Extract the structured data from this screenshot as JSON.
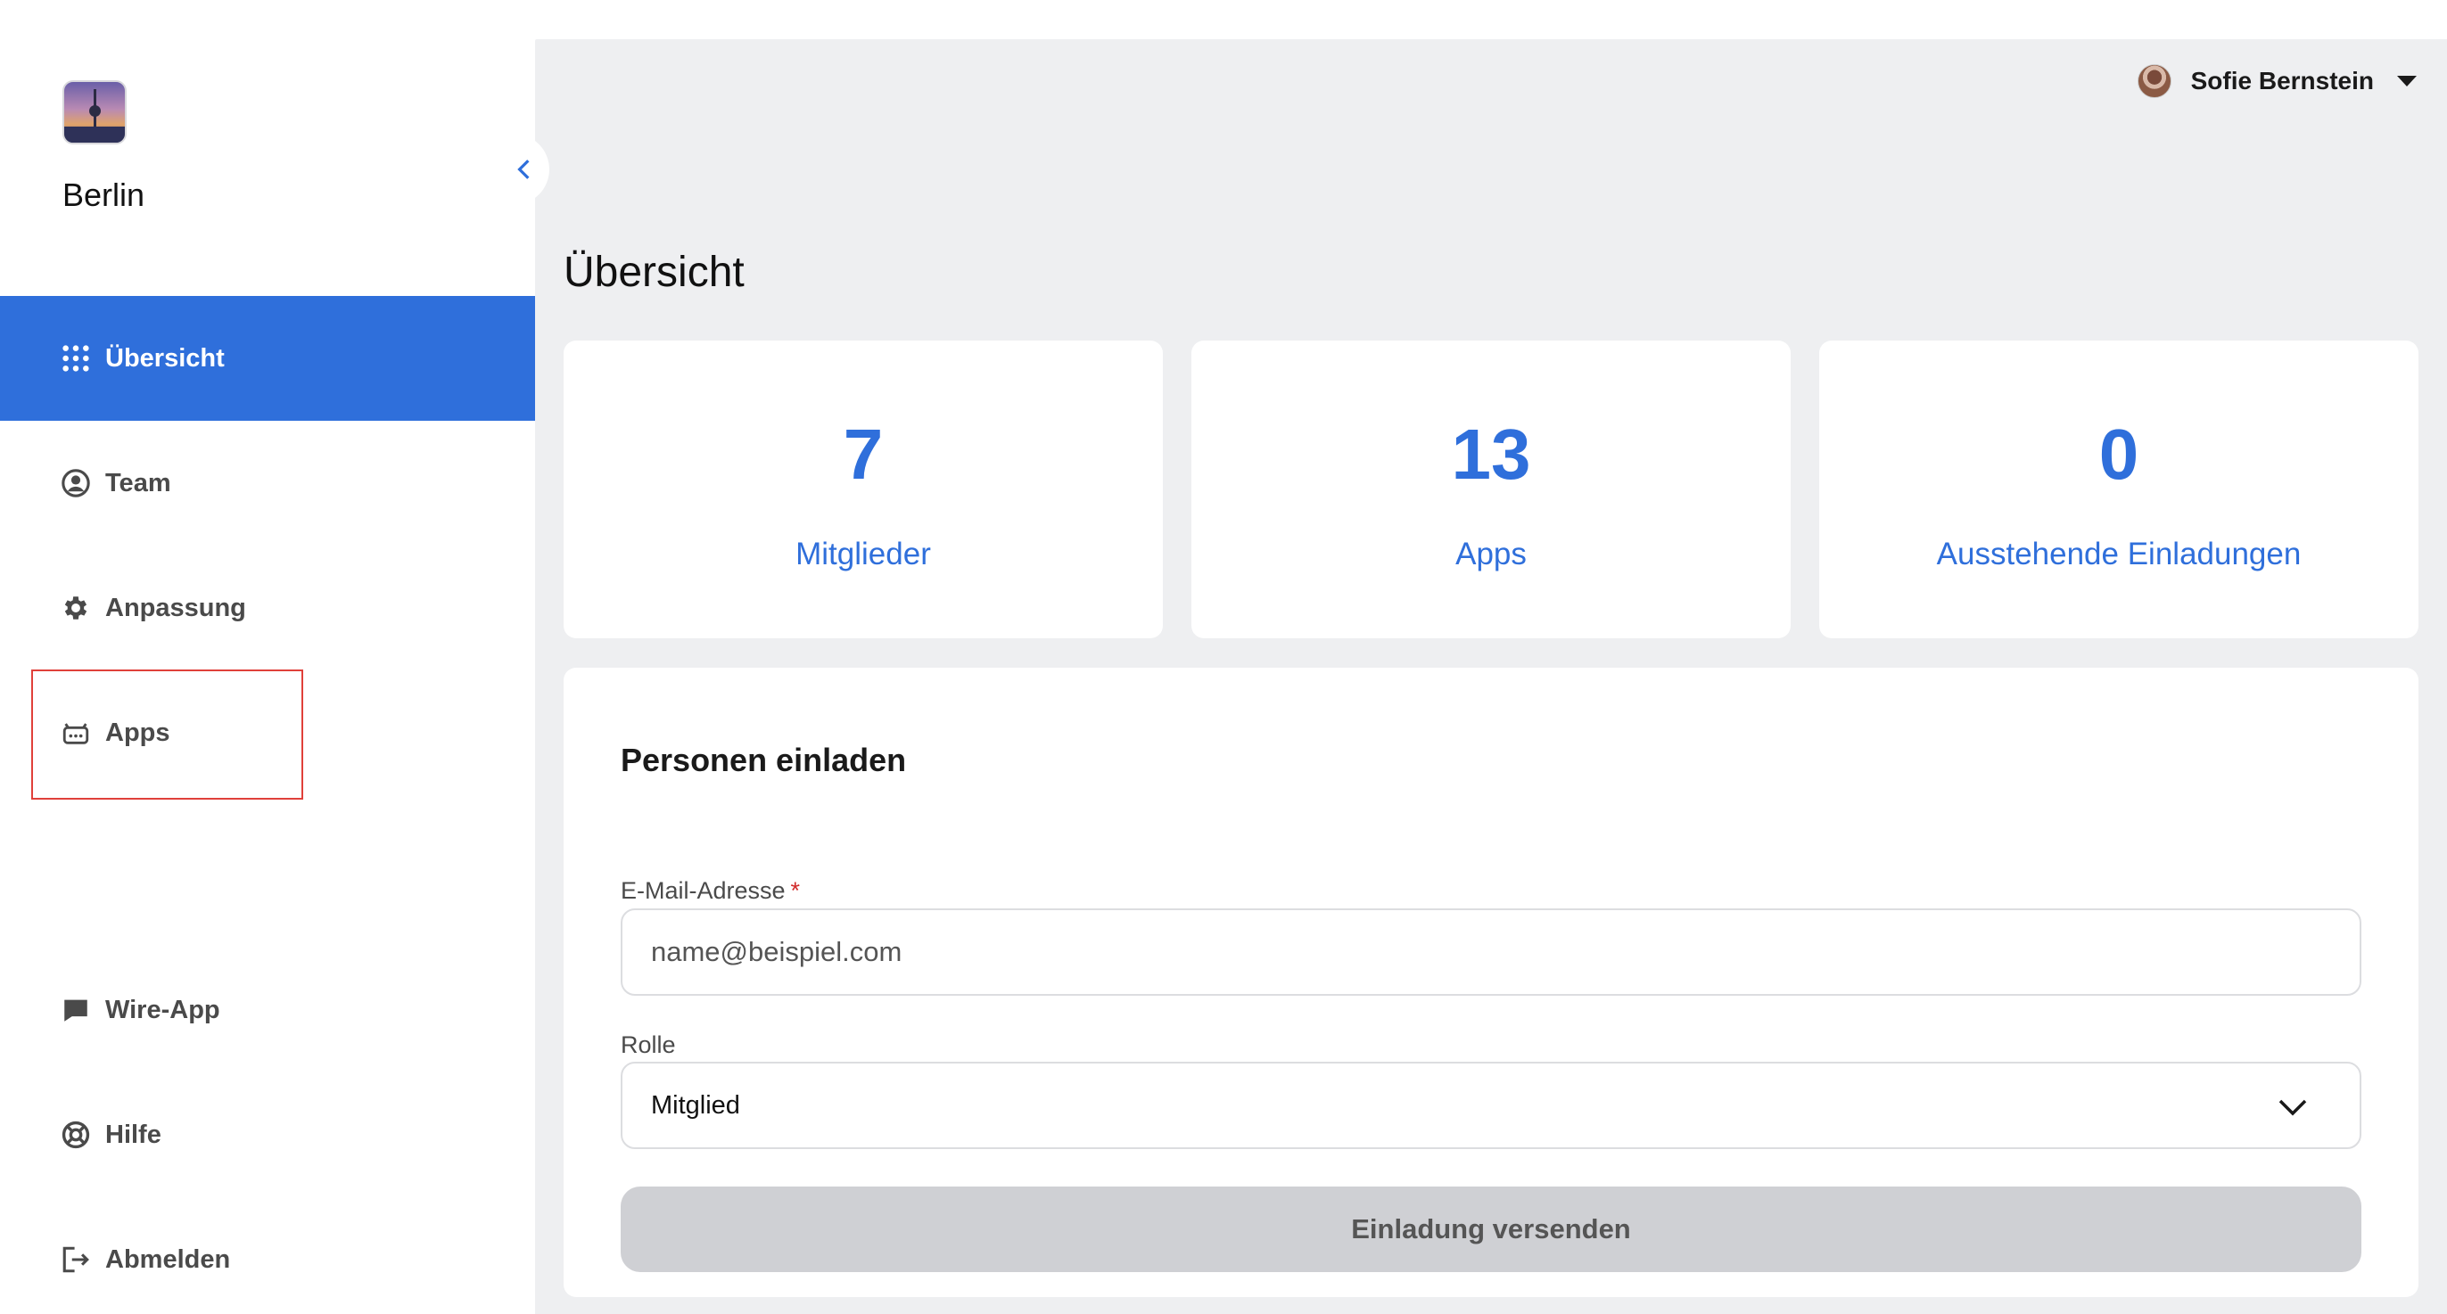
{
  "sidebar": {
    "team_name": "Berlin",
    "items": [
      {
        "label": "Übersicht",
        "icon": "grid-icon",
        "active": true
      },
      {
        "label": "Team",
        "icon": "user-circle-icon"
      },
      {
        "label": "Anpassung",
        "icon": "gear-icon"
      },
      {
        "label": "Apps",
        "icon": "robot-icon"
      },
      {
        "label": "Wire-App",
        "icon": "chat-bubble-icon"
      },
      {
        "label": "Hilfe",
        "icon": "lifebuoy-icon"
      },
      {
        "label": "Abmelden",
        "icon": "logout-icon"
      }
    ]
  },
  "header": {
    "user_name": "Sofie Bernstein"
  },
  "main": {
    "title": "Übersicht",
    "stats": [
      {
        "value": "7",
        "label": "Mitglieder"
      },
      {
        "value": "13",
        "label": "Apps"
      },
      {
        "value": "0",
        "label": "Ausstehende Einladungen"
      }
    ],
    "invite": {
      "title": "Personen einladen",
      "email_label": "E-Mail-Adresse",
      "email_required_mark": "*",
      "email_placeholder": "name@beispiel.com",
      "email_value": "",
      "role_label": "Rolle",
      "role_value": "Mitglied",
      "submit_label": "Einladung versenden"
    }
  },
  "colors": {
    "accent": "#2f6fdb",
    "background": "#eeeff1",
    "button_disabled": "#cfd0d4",
    "highlight": "#e0403a"
  }
}
